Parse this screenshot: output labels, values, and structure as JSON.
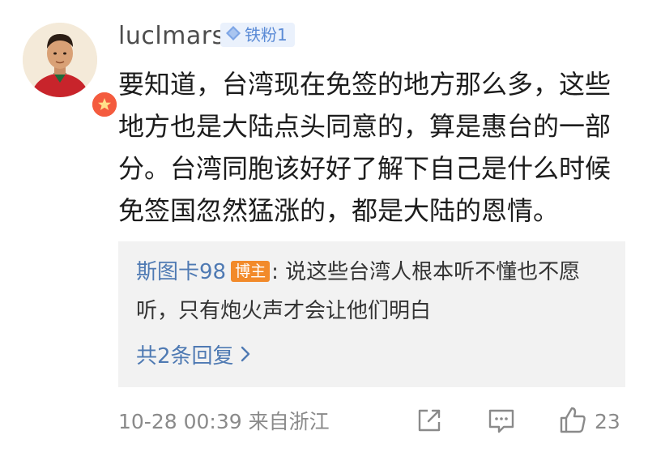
{
  "comment": {
    "avatar_icon": "user-avatar",
    "verified_icon": "verified-badge-icon",
    "username": "luclmars",
    "fan_badge": {
      "icon": "diamond-icon",
      "label": "铁粉1",
      "color": "#5b8bd6"
    },
    "text": "要知道，台湾现在免签的地方那么多，这些地方也是大陆点头同意的，算是惠台的一部分。台湾同胞该好好了解下自己是什么时候免签国忽然猛涨的，都是大陆的恩情。"
  },
  "reply": {
    "author": "斯图卡98",
    "author_badge": "博主",
    "badge_color": "#f28a2a",
    "separator": ":",
    "text": "说这些台湾人根本听不懂也不愿听，只有炮火声才会让他们明白",
    "more_label": "共2条回复",
    "more_icon": "chevron-right-icon"
  },
  "footer": {
    "time_location": "10-28 00:39  来自浙江",
    "share_icon": "share-icon",
    "reply_icon": "comment-icon",
    "like_icon": "thumbs-up-icon",
    "like_count": "23"
  },
  "colors": {
    "link": "#4f7ab3",
    "secondary_text": "#8a8a8a",
    "reply_background": "#f2f2f2"
  }
}
